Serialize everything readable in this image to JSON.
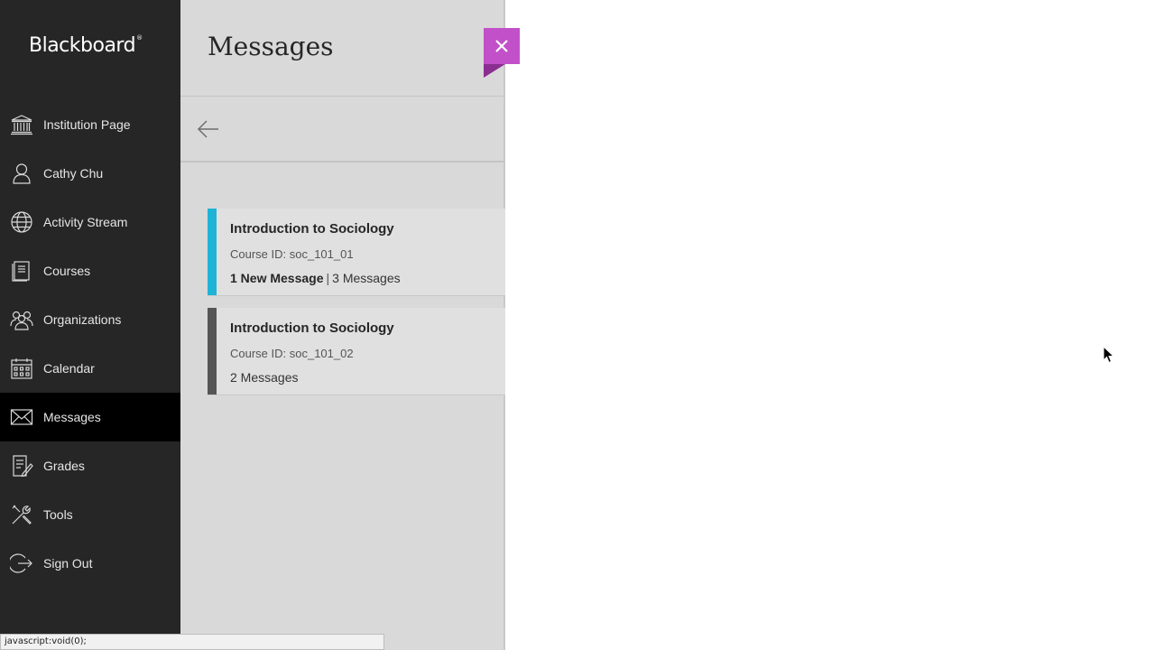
{
  "app": {
    "logo": "Blackboard",
    "logo_mark": "®"
  },
  "sidebar": {
    "items": [
      {
        "label": "Institution Page",
        "icon": "institution-icon",
        "active": false
      },
      {
        "label": "Cathy Chu",
        "icon": "user-icon",
        "active": false
      },
      {
        "label": "Activity Stream",
        "icon": "globe-icon",
        "active": false
      },
      {
        "label": "Courses",
        "icon": "book-icon",
        "active": false
      },
      {
        "label": "Organizations",
        "icon": "group-icon",
        "active": false
      },
      {
        "label": "Calendar",
        "icon": "calendar-icon",
        "active": false
      },
      {
        "label": "Messages",
        "icon": "envelope-icon",
        "active": true
      },
      {
        "label": "Grades",
        "icon": "grades-icon",
        "active": false
      },
      {
        "label": "Tools",
        "icon": "tools-icon",
        "active": false
      },
      {
        "label": "Sign Out",
        "icon": "sign-out-icon",
        "active": false
      }
    ]
  },
  "panel": {
    "title": "Messages",
    "back_icon": "arrow-left-icon",
    "cards": [
      {
        "title": "Introduction to Sociology",
        "course_id": "Course ID: soc_101_01",
        "new_count": "1 New Message",
        "separator": "|",
        "total": "3 Messages",
        "stripe_color": "#1fb3d6"
      },
      {
        "title": "Introduction to Sociology",
        "course_id": "Course ID: soc_101_02",
        "new_count": "",
        "separator": "",
        "total": "2 Messages",
        "stripe_color": "#555555"
      }
    ]
  },
  "close_button": {
    "icon": "close-icon",
    "color": "#c251c9"
  },
  "statusbar": {
    "text": "javascript:void(0);"
  }
}
